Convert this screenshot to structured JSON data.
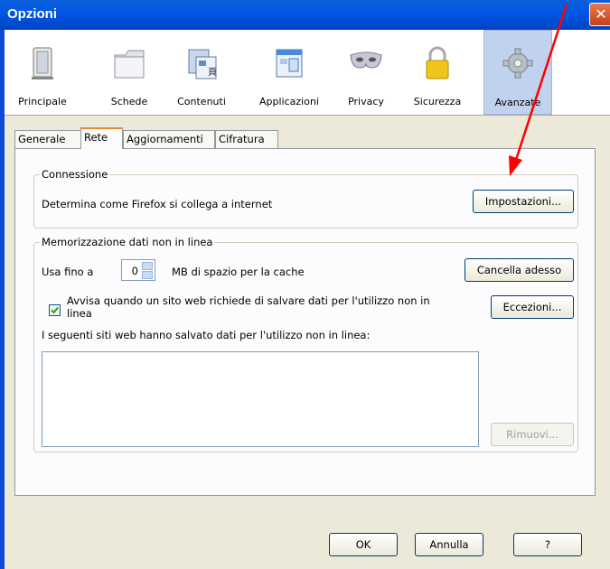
{
  "window": {
    "title": "Opzioni",
    "close_glyph": "✕"
  },
  "toolbar": {
    "items": [
      {
        "label": "Principale",
        "icon": "principale-icon"
      },
      {
        "label": "Schede",
        "icon": "schede-icon"
      },
      {
        "label": "Contenuti",
        "icon": "contenuti-icon"
      },
      {
        "label": "Applicazioni",
        "icon": "applicazioni-icon"
      },
      {
        "label": "Privacy",
        "icon": "privacy-mask-icon"
      },
      {
        "label": "Sicurezza",
        "icon": "padlock-icon"
      },
      {
        "label": "Avanzate",
        "icon": "gear-icon"
      }
    ],
    "selected": "Avanzate"
  },
  "tabs": [
    "Generale",
    "Rete",
    "Aggiornamenti",
    "Cifratura"
  ],
  "selected_tab": "Rete",
  "connessione": {
    "legend": "Connessione",
    "description": "Determina come Firefox si collega a internet",
    "button": "Impostazioni..."
  },
  "offline": {
    "legend": "Memorizzazione dati non in linea",
    "use_up_to": "Usa fino a",
    "cache_value": "0",
    "cache_unit": "MB di spazio per la cache",
    "clear_button": "Cancella adesso",
    "warn_label_line1": "Avvisa quando un sito web richiede di salvare dati per l'utilizzo non in",
    "warn_label_line2": "linea",
    "warn_checked": true,
    "exceptions_button": "Eccezioni...",
    "sites_label": "I seguenti siti web hanno salvato dati per l'utilizzo non in linea:",
    "remove_button": "Rimuovi..."
  },
  "footer": {
    "ok": "OK",
    "cancel": "Annulla",
    "help": "?"
  },
  "colors": {
    "annotation_arrow": "#ff0000",
    "titlebar": "#0058e6"
  }
}
